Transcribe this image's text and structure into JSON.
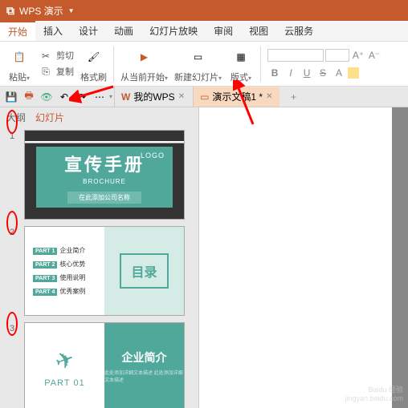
{
  "title": {
    "app_name": "WPS 演示"
  },
  "menu": {
    "tabs": [
      "开始",
      "插入",
      "设计",
      "动画",
      "幻灯片放映",
      "审阅",
      "视图",
      "云服务"
    ]
  },
  "ribbon": {
    "paste": "粘贴",
    "cut": "剪切",
    "copy": "复制",
    "format_painter": "格式刷",
    "from_current": "从当前开始",
    "new_slide": "新建幻灯片",
    "layout": "版式",
    "font_placeholder": "",
    "size_placeholder": ""
  },
  "doctabs": {
    "mywps": "我的WPS",
    "doc1": "演示文稿1 *"
  },
  "side": {
    "outline": "大纲",
    "slides": "幻灯片"
  },
  "slide1": {
    "logo": "LOGO",
    "title": "宣传手册",
    "sub": "BROCHURE",
    "bar": "在此添加公司名称"
  },
  "slide2": {
    "p1": "PART 1 企业简介",
    "p2": "PART 2 核心优势",
    "p3": "PART 3 使用说明",
    "p4": "PART 4 优秀案例",
    "toc": "目录"
  },
  "slide3": {
    "part": "PART 01",
    "title": "企业简介",
    "lines": "此处添加详细文本描述\n此处添加详细文本描述"
  },
  "watermark": {
    "brand": "Baidu 经验",
    "url": "jingyan.baidu.com"
  }
}
